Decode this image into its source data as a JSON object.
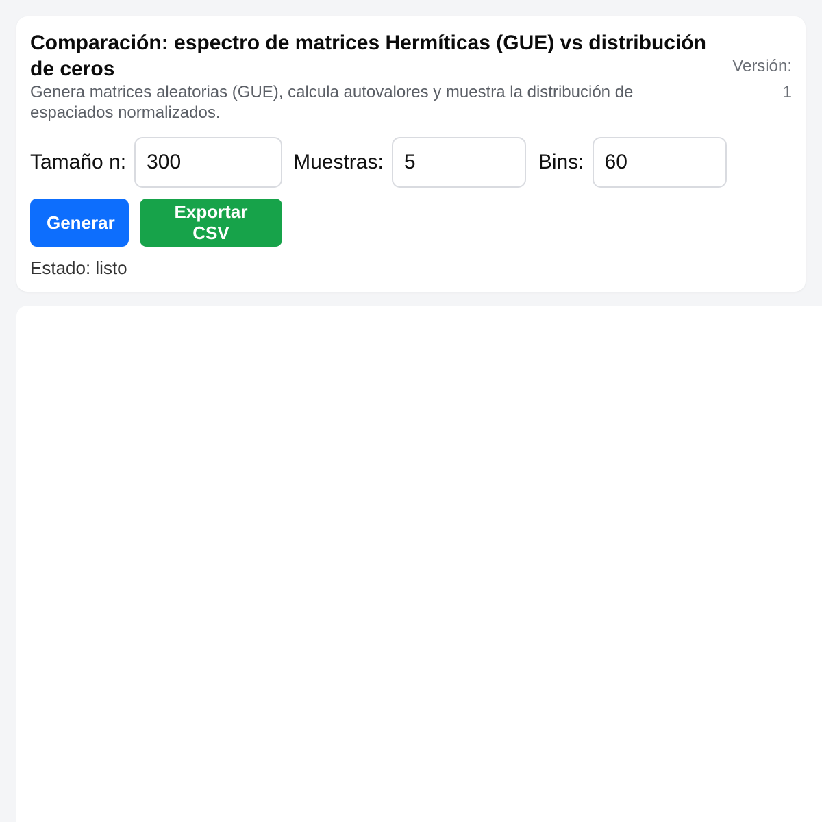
{
  "header": {
    "title": "Comparación: espectro de matrices Hermíticas (GUE) vs distribución de ceros",
    "subtitle": "Genera matrices aleatorias (GUE), calcula autovalores y muestra la distribución de espaciados normalizados.",
    "version_label": "Versión:",
    "version_value": "1"
  },
  "controls": {
    "size_label": "Tamaño n:",
    "size_value": "300",
    "samples_label": "Muestras:",
    "samples_value": "5",
    "bins_label": "Bins:",
    "bins_value": "60"
  },
  "buttons": {
    "generate_label": "Generar",
    "export_label": "Exportar CSV"
  },
  "status": {
    "text": "Estado: listo"
  },
  "colors": {
    "primary": "#0d6efd",
    "success": "#17a34a",
    "background": "#f4f5f7"
  }
}
